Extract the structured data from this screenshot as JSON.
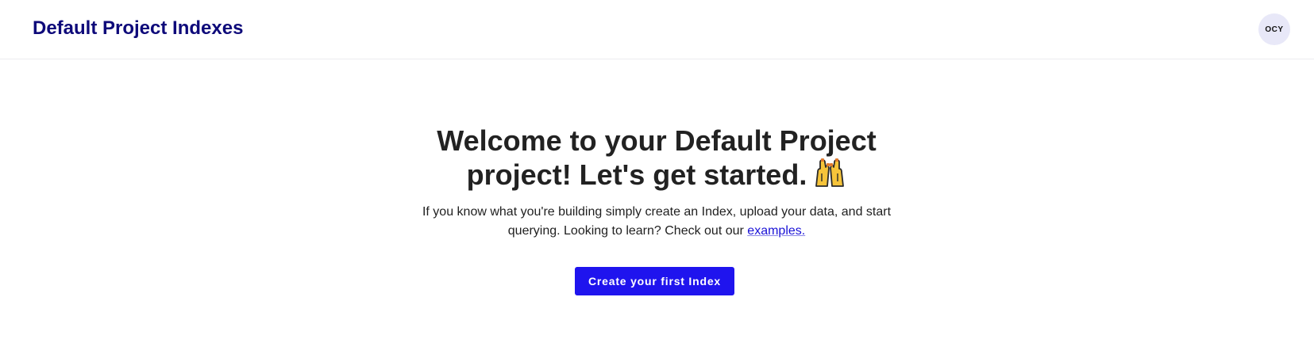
{
  "header": {
    "title": "Default Project Indexes",
    "avatar_initials": "OCY"
  },
  "main": {
    "welcome_line1": "Welcome to your Default Project",
    "welcome_line2": "project! Let's get started.",
    "welcome_icon": "raising-hands-icon",
    "intro_text": "If you know what you're building simply create an Index, upload your data, and start querying. Looking to learn? Check out our ",
    "examples_link": "examples.",
    "cta_label": "Create your first Index"
  },
  "colors": {
    "title": "#0e0a7a",
    "avatar_bg": "#e8e8f8",
    "button_bg": "#1f14ee",
    "link": "#1a12d6",
    "heading": "#222222"
  }
}
